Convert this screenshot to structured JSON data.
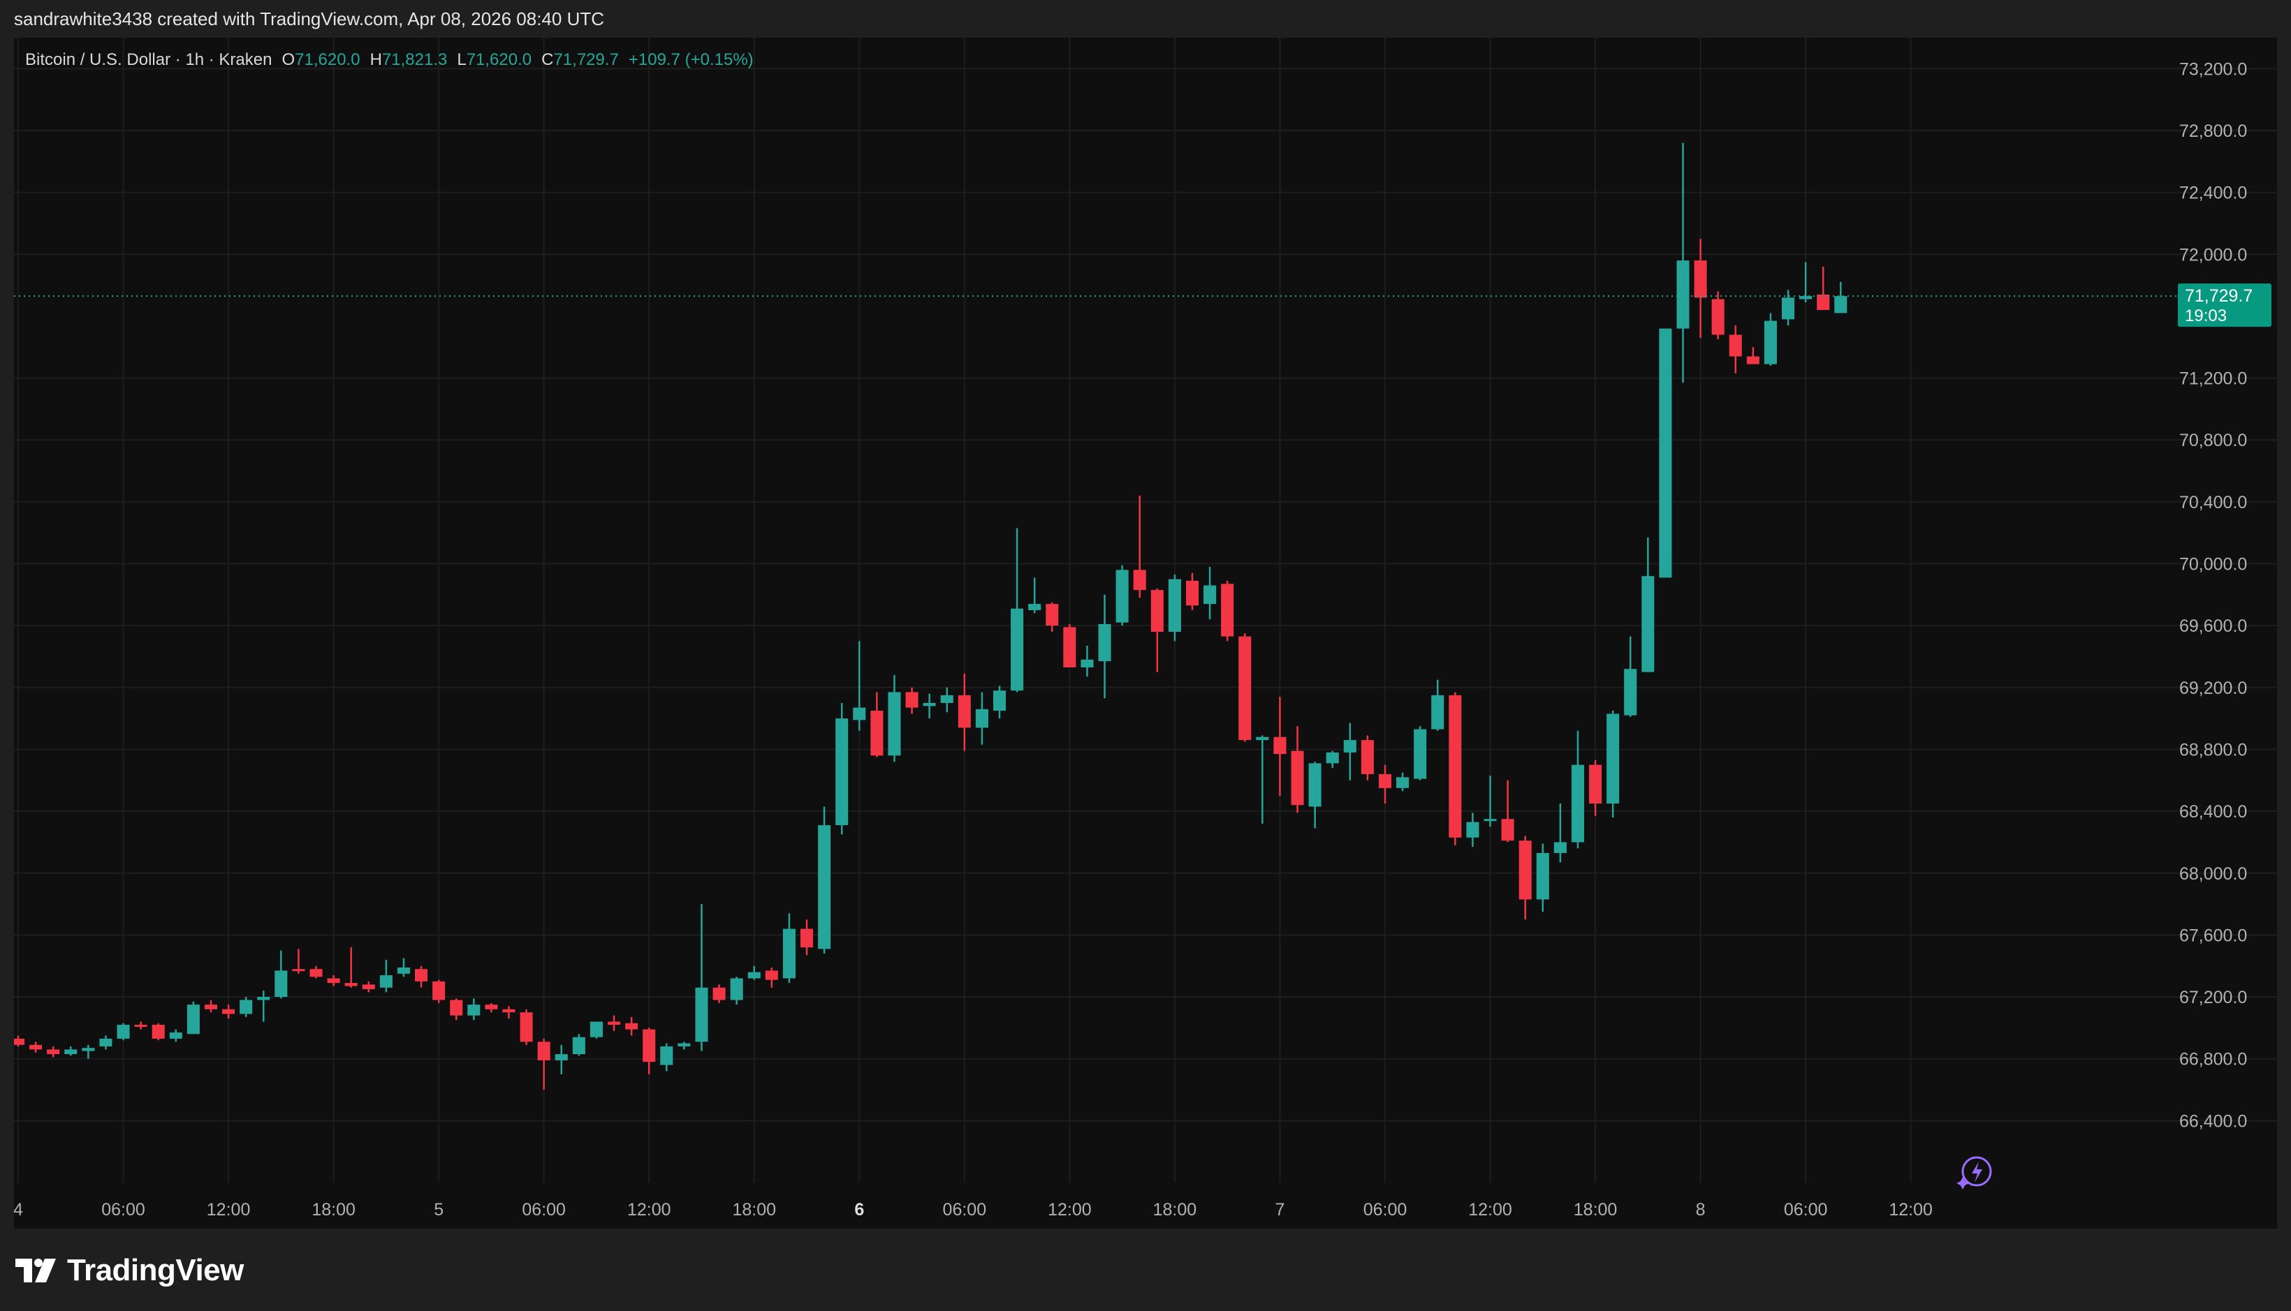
{
  "header": {
    "text": "sandrawhite3438 created with TradingView.com, Apr 08, 2026 08:40 UTC"
  },
  "legend": {
    "symbol": "Bitcoin / U.S. Dollar · 1h · Kraken",
    "open_label": "O",
    "open": "71,620.0",
    "high_label": "H",
    "high": "71,821.3",
    "low_label": "L",
    "low": "71,620.0",
    "close_label": "C",
    "close": "71,729.7",
    "change": "+109.7 (+0.15%)"
  },
  "brand": {
    "name": "TradingView"
  },
  "colors": {
    "up": "#26a69a",
    "down": "#f23645",
    "grid": "#1e1e1e",
    "axis_text": "#b2b2b2",
    "price_tag_bg": "#089981",
    "background": "#0f0f0f"
  },
  "price_tag": {
    "price": "71,729.7",
    "countdown": "19:03",
    "value": 71729.7
  },
  "chart_data": {
    "type": "candlestick",
    "interval": "1h",
    "ylim": [
      66000,
      73400
    ],
    "xlim": [
      0,
      123
    ],
    "y_ticks": [
      {
        "value": 66400,
        "label": "66,400.0"
      },
      {
        "value": 66800,
        "label": "66,800.0"
      },
      {
        "value": 67200,
        "label": "67,200.0"
      },
      {
        "value": 67600,
        "label": "67,600.0"
      },
      {
        "value": 68000,
        "label": "68,000.0"
      },
      {
        "value": 68400,
        "label": "68,400.0"
      },
      {
        "value": 68800,
        "label": "68,800.0"
      },
      {
        "value": 69200,
        "label": "69,200.0"
      },
      {
        "value": 69600,
        "label": "69,600.0"
      },
      {
        "value": 70000,
        "label": "70,000.0"
      },
      {
        "value": 70400,
        "label": "70,400.0"
      },
      {
        "value": 70800,
        "label": "70,800.0"
      },
      {
        "value": 71200,
        "label": "71,200.0"
      },
      {
        "value": 72000,
        "label": "72,000.0"
      },
      {
        "value": 72400,
        "label": "72,400.0"
      },
      {
        "value": 72800,
        "label": "72,800.0"
      },
      {
        "value": 73200,
        "label": "73,200.0"
      }
    ],
    "x_ticks": [
      {
        "index": 0,
        "label": "4",
        "bold": false
      },
      {
        "index": 6,
        "label": "06:00",
        "bold": false
      },
      {
        "index": 12,
        "label": "12:00",
        "bold": false
      },
      {
        "index": 18,
        "label": "18:00",
        "bold": false
      },
      {
        "index": 24,
        "label": "5",
        "bold": false
      },
      {
        "index": 30,
        "label": "06:00",
        "bold": false
      },
      {
        "index": 36,
        "label": "12:00",
        "bold": false
      },
      {
        "index": 42,
        "label": "18:00",
        "bold": false
      },
      {
        "index": 48,
        "label": "6",
        "bold": true
      },
      {
        "index": 54,
        "label": "06:00",
        "bold": false
      },
      {
        "index": 60,
        "label": "12:00",
        "bold": false
      },
      {
        "index": 66,
        "label": "18:00",
        "bold": false
      },
      {
        "index": 72,
        "label": "7",
        "bold": false
      },
      {
        "index": 78,
        "label": "06:00",
        "bold": false
      },
      {
        "index": 84,
        "label": "12:00",
        "bold": false
      },
      {
        "index": 90,
        "label": "18:00",
        "bold": false
      },
      {
        "index": 96,
        "label": "8",
        "bold": false
      },
      {
        "index": 102,
        "label": "06:00",
        "bold": false
      },
      {
        "index": 108,
        "label": "12:00",
        "bold": false
      }
    ],
    "ohlc": [
      [
        66930,
        66950,
        66880,
        66890
      ],
      [
        66890,
        66910,
        66840,
        66860
      ],
      [
        66860,
        66880,
        66810,
        66830
      ],
      [
        66830,
        66880,
        66820,
        66860
      ],
      [
        66850,
        66890,
        66800,
        66870
      ],
      [
        66880,
        66950,
        66860,
        66930
      ],
      [
        66930,
        67030,
        66920,
        67020
      ],
      [
        67020,
        67040,
        66990,
        67010
      ],
      [
        67020,
        67030,
        66920,
        66930
      ],
      [
        66930,
        66990,
        66910,
        66970
      ],
      [
        66960,
        67170,
        66960,
        67150
      ],
      [
        67150,
        67180,
        67100,
        67120
      ],
      [
        67120,
        67150,
        67060,
        67090
      ],
      [
        67090,
        67200,
        67070,
        67180
      ],
      [
        67180,
        67240,
        67040,
        67200
      ],
      [
        67200,
        67500,
        67190,
        67370
      ],
      [
        67380,
        67510,
        67350,
        67370
      ],
      [
        67380,
        67400,
        67320,
        67330
      ],
      [
        67320,
        67340,
        67270,
        67290
      ],
      [
        67290,
        67520,
        67260,
        67270
      ],
      [
        67280,
        67300,
        67230,
        67250
      ],
      [
        67260,
        67440,
        67230,
        67340
      ],
      [
        67350,
        67450,
        67330,
        67390
      ],
      [
        67380,
        67400,
        67260,
        67300
      ],
      [
        67300,
        67310,
        67160,
        67180
      ],
      [
        67180,
        67190,
        67050,
        67080
      ],
      [
        67080,
        67190,
        67050,
        67150
      ],
      [
        67150,
        67160,
        67100,
        67120
      ],
      [
        67120,
        67140,
        67060,
        67100
      ],
      [
        67100,
        67120,
        66890,
        66910
      ],
      [
        66910,
        66930,
        66600,
        66790
      ],
      [
        66790,
        66890,
        66700,
        66830
      ],
      [
        66830,
        66960,
        66820,
        66940
      ],
      [
        66940,
        67040,
        66930,
        67040
      ],
      [
        67040,
        67080,
        66980,
        67020
      ],
      [
        67030,
        67070,
        66950,
        66990
      ],
      [
        66990,
        67000,
        66700,
        66780
      ],
      [
        66760,
        66900,
        66720,
        66880
      ],
      [
        66880,
        66910,
        66860,
        66900
      ],
      [
        66910,
        67800,
        66850,
        67260
      ],
      [
        67260,
        67280,
        67160,
        67180
      ],
      [
        67180,
        67330,
        67150,
        67320
      ],
      [
        67320,
        67400,
        67310,
        67360
      ],
      [
        67370,
        67390,
        67260,
        67310
      ],
      [
        67320,
        67740,
        67290,
        67640
      ],
      [
        67640,
        67700,
        67470,
        67520
      ],
      [
        67510,
        68430,
        67480,
        68310
      ],
      [
        68310,
        69100,
        68250,
        69000
      ],
      [
        68990,
        69500,
        68920,
        69070
      ],
      [
        69050,
        69170,
        68750,
        68760
      ],
      [
        68760,
        69280,
        68720,
        69170
      ],
      [
        69170,
        69200,
        69030,
        69070
      ],
      [
        69080,
        69160,
        69000,
        69100
      ],
      [
        69100,
        69200,
        69040,
        69150
      ],
      [
        69150,
        69290,
        68790,
        68940
      ],
      [
        68940,
        69170,
        68830,
        69060
      ],
      [
        69050,
        69210,
        69000,
        69180
      ],
      [
        69180,
        70230,
        69170,
        69710
      ],
      [
        69700,
        69910,
        69680,
        69740
      ],
      [
        69740,
        69750,
        69560,
        69600
      ],
      [
        69590,
        69610,
        69330,
        69330
      ],
      [
        69330,
        69470,
        69270,
        69380
      ],
      [
        69370,
        69800,
        69130,
        69610
      ],
      [
        69620,
        69990,
        69600,
        69960
      ],
      [
        69960,
        70440,
        69780,
        69830
      ],
      [
        69830,
        69840,
        69300,
        69560
      ],
      [
        69560,
        69930,
        69500,
        69900
      ],
      [
        69890,
        69940,
        69700,
        69730
      ],
      [
        69740,
        69980,
        69640,
        69860
      ],
      [
        69870,
        69890,
        69500,
        69530
      ],
      [
        69530,
        69550,
        68850,
        68860
      ],
      [
        68860,
        68890,
        68320,
        68880
      ],
      [
        68880,
        69140,
        68500,
        68770
      ],
      [
        68790,
        68950,
        68390,
        68440
      ],
      [
        68430,
        68720,
        68290,
        68710
      ],
      [
        68710,
        68790,
        68680,
        68780
      ],
      [
        68780,
        68970,
        68600,
        68860
      ],
      [
        68860,
        68890,
        68600,
        68640
      ],
      [
        68640,
        68700,
        68450,
        68550
      ],
      [
        68550,
        68650,
        68530,
        68620
      ],
      [
        68610,
        68950,
        68600,
        68930
      ],
      [
        68930,
        69250,
        68920,
        69150
      ],
      [
        69150,
        69170,
        68180,
        68230
      ],
      [
        68230,
        68390,
        68170,
        68330
      ],
      [
        68340,
        68630,
        68300,
        68350
      ],
      [
        68350,
        68600,
        68200,
        68210
      ],
      [
        68210,
        68240,
        67700,
        67830
      ],
      [
        67830,
        68190,
        67750,
        68130
      ],
      [
        68130,
        68450,
        68070,
        68200
      ],
      [
        68200,
        68920,
        68160,
        68700
      ],
      [
        68700,
        68730,
        68370,
        68450
      ],
      [
        68450,
        69050,
        68360,
        69030
      ],
      [
        69020,
        69530,
        69010,
        69320
      ],
      [
        69300,
        70170,
        69300,
        69920
      ],
      [
        69910,
        71500,
        69910,
        71520
      ],
      [
        71520,
        72720,
        71170,
        71960
      ],
      [
        71960,
        72100,
        71460,
        71720
      ],
      [
        71710,
        71760,
        71450,
        71480
      ],
      [
        71480,
        71540,
        71230,
        71340
      ],
      [
        71340,
        71400,
        71290,
        71290
      ],
      [
        71290,
        71620,
        71280,
        71570
      ],
      [
        71580,
        71770,
        71540,
        71720
      ],
      [
        71710,
        71950,
        71690,
        71730
      ],
      [
        71740,
        71920,
        71640,
        71640
      ],
      [
        71620,
        71821.3,
        71620,
        71729.7
      ]
    ]
  }
}
